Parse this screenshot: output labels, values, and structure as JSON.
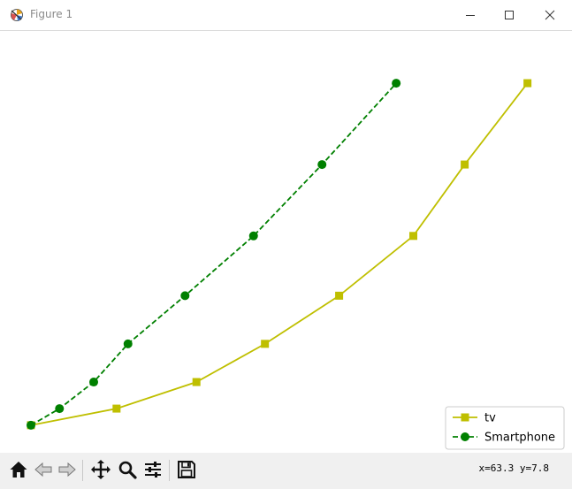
{
  "window": {
    "title": "Figure 1",
    "controls": [
      "minimize-icon",
      "maximize-icon",
      "close-icon"
    ]
  },
  "toolbar": {
    "buttons": [
      "home-icon",
      "back-icon",
      "forward-icon",
      "pan-icon",
      "zoom-icon",
      "configure-subplots-icon",
      "save-icon"
    ],
    "coordinates": "x=63.3 y=7.8"
  },
  "chart_data": {
    "type": "line",
    "title": "",
    "xlabel": "",
    "ylabel": "",
    "axes_visible": false,
    "grid": false,
    "legend_position": "lower-right",
    "xlim": [
      0,
      90
    ],
    "ylim": [
      1.3,
      25
    ],
    "series": [
      {
        "name": "tv",
        "color": "#bfbf00",
        "linestyle": "solid",
        "marker": "square",
        "x": [
          0,
          15,
          29,
          41,
          54,
          67,
          76,
          87
        ],
        "y": [
          2.0,
          3.0,
          4.6,
          6.9,
          9.8,
          13.4,
          17.7,
          22.6
        ]
      },
      {
        "name": "Smartphone",
        "color": "#008000",
        "linestyle": "dashed",
        "marker": "circle",
        "x": [
          0,
          5,
          11,
          17,
          27,
          39,
          51,
          64
        ],
        "y": [
          2.0,
          3.0,
          4.6,
          6.9,
          9.8,
          13.4,
          17.7,
          22.6
        ]
      }
    ]
  }
}
